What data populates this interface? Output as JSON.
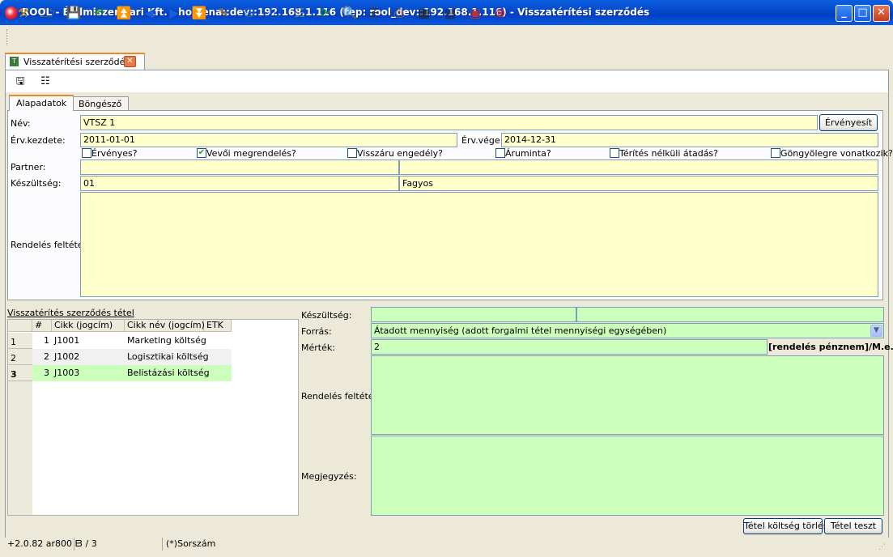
{
  "window": {
    "title": "ROOL - Élelmiszeripari Kft. - homena::dev::192.168.1.116 (rep: rool_dev::192.168.1.116) - Visszatérítési szerződés"
  },
  "toolbar": {
    "icons": [
      "tools-icon",
      "open-folder-icon",
      "save-icon",
      "undo-icon",
      "first-record-icon",
      "previous-icon",
      "next-icon",
      "last-record-icon",
      "edit-icon",
      "database-icon",
      "info-icon",
      "list-view-icon",
      "refresh-icon",
      "search-icon",
      "columns-icon",
      "print-preview-icon",
      "grid-export-icon",
      "grid-import-icon",
      "screen-icon",
      "close-red-icon"
    ]
  },
  "doc_tab": {
    "label": "Visszatérítési szerződés",
    "icon": "T"
  },
  "inner_tabs": [
    {
      "label": "Alapadatok"
    },
    {
      "label": "Böngésző"
    }
  ],
  "form": {
    "name_label": "Név:",
    "name_value": "VTSZ 1",
    "validate_button": "Érvényesít",
    "start_label": "Érv.kezdete:",
    "start_value": "2011-01-01",
    "end_label": "Érv.vége:",
    "end_value": "2014-12-31",
    "checkboxes": [
      {
        "label": "Érvényes?",
        "checked": false
      },
      {
        "label": "Vevői megrendelés?",
        "checked": true
      },
      {
        "label": "Visszáru engedély?",
        "checked": false
      },
      {
        "label": "Áruminta?",
        "checked": false
      },
      {
        "label": "Térítés nélküli átadás?",
        "checked": false
      },
      {
        "label": "Göngyölegre vonatkozik?",
        "checked": false
      }
    ],
    "partner_label": "Partner:",
    "partner_code": "",
    "partner_name": "",
    "status_label": "Készültség:",
    "status_code": "01",
    "status_name": "Fagyos",
    "order_condition_label": "Rendelés feltétel:",
    "order_condition_value": ""
  },
  "items_section": {
    "title": "Visszatérítés szerződés tétel",
    "columns": [
      "#",
      "Cikk (jogcím)",
      "Cikk név (jogcím)",
      "ETK"
    ],
    "rows": [
      {
        "row": "1",
        "num": "1",
        "code": "J1001",
        "name": "Marketing költség",
        "etk": ""
      },
      {
        "row": "2",
        "num": "2",
        "code": "J1002",
        "name": "Logisztikai költség",
        "etk": ""
      },
      {
        "row": "3",
        "num": "3",
        "code": "J1003",
        "name": "Belistázási költség",
        "etk": ""
      }
    ],
    "selected_row": 3
  },
  "item_detail": {
    "status_label": "Készültség:",
    "status_code": "",
    "status_name": "",
    "source_label": "Forrás:",
    "source_value": "Átadott mennyiség (adott forgalmi tétel mennyiségi egységében)",
    "measure_label": "Mérték:",
    "measure_value": "2",
    "measure_unit": "[rendelés pénznem]/M.e.",
    "order_condition_label": "Rendelés feltétel:",
    "order_condition_value": "",
    "comment_label": "Megjegyzés:",
    "comment_value": "",
    "delete_cost_button": "Tétel költség törlés",
    "test_button": "Tétel teszt"
  },
  "status_bar": {
    "version": "+2.0.82 ar800 E",
    "record_count": "3 / 3",
    "sort_hint": "(*)Sorszám"
  },
  "colors": {
    "yellow_field": "#ffffcc",
    "green_field": "#ccffbb",
    "titlebar": "#0a5fe0"
  }
}
